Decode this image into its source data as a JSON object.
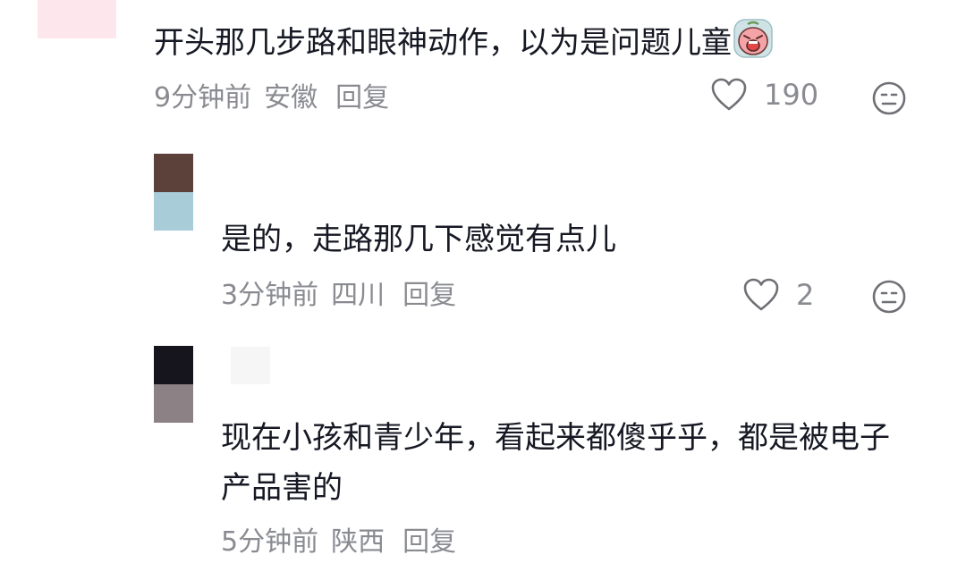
{
  "comments": [
    {
      "text": "开头那几步路和眼神动作，以为是问题儿童",
      "emoji": "crying-face-sticker",
      "time": "9分钟前",
      "location": "安徽",
      "reply_label": "回复",
      "likes": "190"
    }
  ],
  "replies": [
    {
      "text": "是的，走路那几下感觉有点儿",
      "time": "3分钟前",
      "location": "四川",
      "reply_label": "回复",
      "likes": "2"
    },
    {
      "text": "现在小孩和青少年，看起来都傻乎乎，都是被电子产品害的",
      "time": "5分钟前",
      "location": "陕西",
      "reply_label": "回复"
    }
  ],
  "colors": {
    "text": "#161823",
    "meta": "#8a8b91",
    "icon": "#6f7075"
  },
  "icons": {
    "like": "heart-outline-icon",
    "dislike": "neutral-face-icon"
  }
}
